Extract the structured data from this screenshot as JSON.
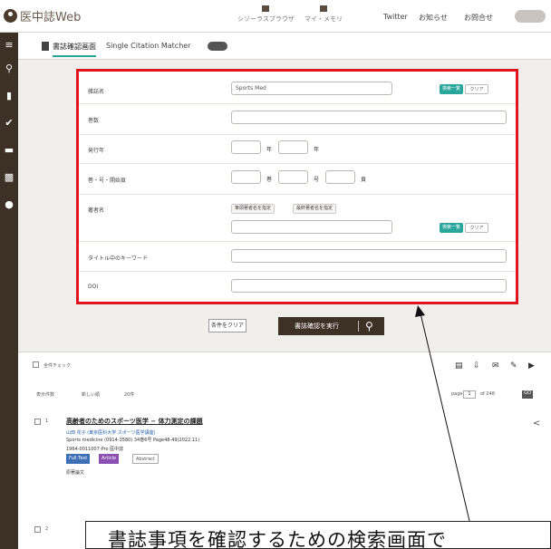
{
  "header": {
    "app_name": "医中誌Web",
    "nav": [
      {
        "label": "シソーラスブラウザ"
      },
      {
        "label": "マイ・メモリ"
      }
    ],
    "links": [
      "Twitter",
      "お知らせ",
      "お問合せ"
    ]
  },
  "tabs": {
    "active": "書誌確認画面",
    "second": "Single Citation Matcher"
  },
  "form": {
    "rows": [
      {
        "label": "雑誌名",
        "value": "Sports Med",
        "btn1": "検索一覧",
        "btn2": "クリア"
      },
      {
        "label": "巻数"
      },
      {
        "label": "発行年",
        "from_sep": "年",
        "to_sep": "年"
      },
      {
        "label": "巻・号・開始頁",
        "sep1": "巻",
        "sep2": "号",
        "sep3": "頁"
      },
      {
        "label": "著者名",
        "chip1": "筆頭著者名を指定",
        "chip2": "最終著者名を指定",
        "btn1": "検索一覧",
        "btn2": "クリア"
      },
      {
        "label": "タイトル中のキーワード"
      },
      {
        "label": "DOI"
      }
    ]
  },
  "actions": {
    "clear": "条件をクリア",
    "search": "書誌確認を実行"
  },
  "results": {
    "select_all": "全件チェック",
    "sort_label": "表示件数",
    "sort1": "新しい順",
    "sort2": "20件",
    "page_label": "page",
    "page": "1",
    "of_label": "of 248",
    "go": "GO",
    "items": [
      {
        "no": "1",
        "title": "高齢者のためのスポーツ医学 − 体力測定の課題",
        "line1": "山田 花子 (東京医科大学 スポーツ医学講座)",
        "line2": "Sports medicine (0914-3580) 34巻6号 Page48-49(2022.11)",
        "line3": "1964-0011007-Pro 医中誌",
        "badges": [
          "Full Text",
          "Article",
          "Abstract"
        ],
        "note": "原著論文"
      },
      {
        "no": "2"
      }
    ]
  },
  "callout": {
    "text": "書誌事項を確認するための検索画面で"
  },
  "colors": {
    "highlight": "#e0141c",
    "teal": "#2aa59c",
    "dark": "#3d3126"
  }
}
